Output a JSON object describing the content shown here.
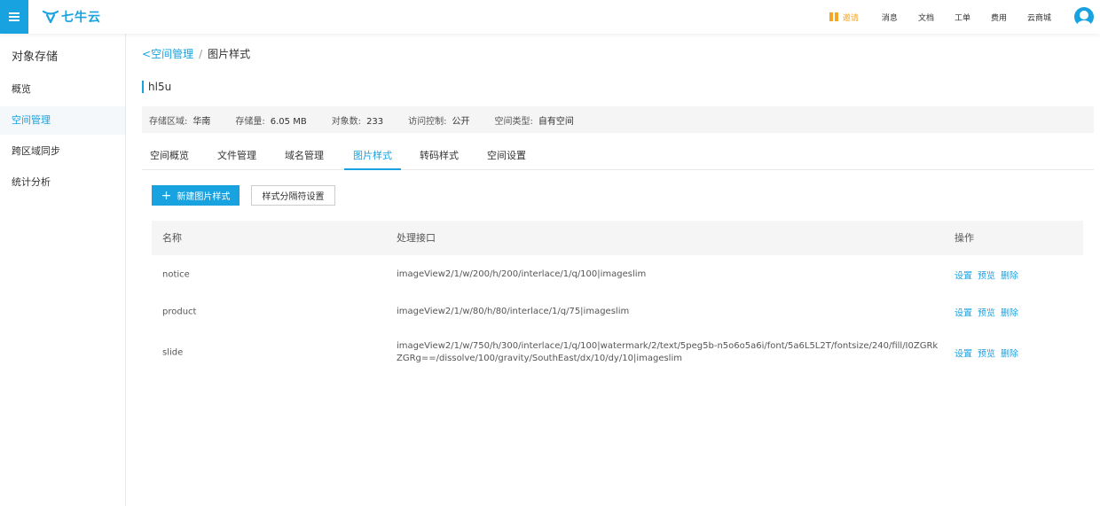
{
  "header": {
    "logo_text": "七牛云",
    "nav": {
      "invite": "邀请",
      "messages": "消息",
      "docs": "文档",
      "tickets": "工单",
      "billing": "费用",
      "market": "云商城"
    }
  },
  "sidebar": {
    "title": "对象存储",
    "items": [
      {
        "label": "概览"
      },
      {
        "label": "空间管理"
      },
      {
        "label": "跨区域同步"
      },
      {
        "label": "统计分析"
      }
    ]
  },
  "breadcrumb": {
    "back": "空间管理",
    "separator": "/",
    "current": "图片样式"
  },
  "bucket": {
    "name": "hl5u"
  },
  "info": {
    "region_label": "存储区域:",
    "region_value": "华南",
    "storage_label": "存储量:",
    "storage_value": "6.05 MB",
    "objects_label": "对象数:",
    "objects_value": "233",
    "access_label": "访问控制:",
    "access_value": "公开",
    "type_label": "空间类型:",
    "type_value": "自有空间"
  },
  "tabs": [
    {
      "label": "空间概览"
    },
    {
      "label": "文件管理"
    },
    {
      "label": "域名管理"
    },
    {
      "label": "图片样式"
    },
    {
      "label": "转码样式"
    },
    {
      "label": "空间设置"
    }
  ],
  "actions": {
    "new_style": "新建图片样式",
    "separator_setting": "样式分隔符设置"
  },
  "table": {
    "headers": {
      "name": "名称",
      "interface": "处理接口",
      "actions": "操作"
    },
    "rows": [
      {
        "name": "notice",
        "interface": "imageView2/1/w/200/h/200/interlace/1/q/100|imageslim",
        "op1": "设置",
        "op2": "预览",
        "op3": "删除"
      },
      {
        "name": "product",
        "interface": "imageView2/1/w/80/h/80/interlace/1/q/75|imageslim",
        "op1": "设置",
        "op2": "预览",
        "op3": "删除"
      },
      {
        "name": "slide",
        "interface": "imageView2/1/w/750/h/300/interlace/1/q/100|watermark/2/text/5peg5b-n5o6o5a6i/font/5a6L5L2T/fontsize/240/fill/I0ZGRkZGRg==/dissolve/100/gravity/SouthEast/dx/10/dy/10|imageslim",
        "op1": "设置",
        "op2": "预览",
        "op3": "删除"
      }
    ]
  },
  "colors": {
    "accent": "#19a2e0",
    "invite": "#f5a623"
  }
}
